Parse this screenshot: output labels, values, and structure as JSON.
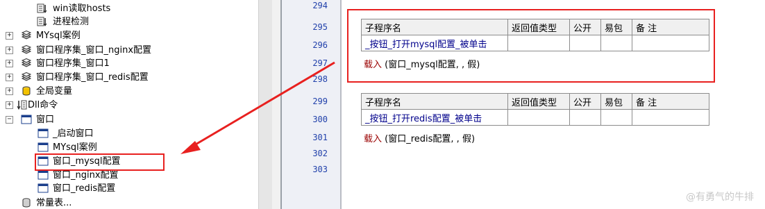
{
  "tree": {
    "items": [
      {
        "label": "win读取hosts",
        "icon": "file-list-icon"
      },
      {
        "label": "进程检测",
        "icon": "file-list-icon"
      },
      {
        "label": "MYsql案例",
        "icon": "module-stack-icon"
      },
      {
        "label": "窗口程序集_窗口_nginx配置",
        "icon": "module-stack-icon"
      },
      {
        "label": "窗口程序集_窗口1",
        "icon": "module-stack-icon"
      },
      {
        "label": "窗口程序集_窗口_redis配置",
        "icon": "module-stack-icon"
      },
      {
        "label": "全局变量",
        "icon": "database-icon"
      },
      {
        "label": "Dll命令",
        "icon": "dll-command-icon"
      },
      {
        "label": "窗口",
        "icon": "window-icon"
      },
      {
        "label": "_启动窗口",
        "icon": "window-icon"
      },
      {
        "label": "MYsql案例",
        "icon": "window-icon"
      },
      {
        "label": "窗口_mysql配置",
        "icon": "window-icon"
      },
      {
        "label": "窗口_nginx配置",
        "icon": "window-icon"
      },
      {
        "label": "窗口_redis配置",
        "icon": "window-icon"
      },
      {
        "label": "常量表...",
        "icon": "constant-table-icon"
      }
    ]
  },
  "editor": {
    "line_numbers": [
      "294",
      "295",
      "296",
      "297",
      "298",
      "299",
      "300",
      "301",
      "302",
      "303"
    ],
    "table1": {
      "headers": [
        "子程序名",
        "返回值类型",
        "公开",
        "易包",
        "备 注"
      ],
      "name": "_按钮_打开mysql配置_被单击",
      "call_kw": "载入",
      "call_args": " (窗口_mysql配置, , 假)"
    },
    "table2": {
      "headers": [
        "子程序名",
        "返回值类型",
        "公开",
        "易包",
        "备 注"
      ],
      "name": "_按钮_打开redis配置_被单击",
      "call_kw": "载入",
      "call_args": " (窗口_redis配置, , 假)"
    }
  },
  "annotation": {
    "color": "#e8201f"
  },
  "watermark": "@有勇气的牛排"
}
